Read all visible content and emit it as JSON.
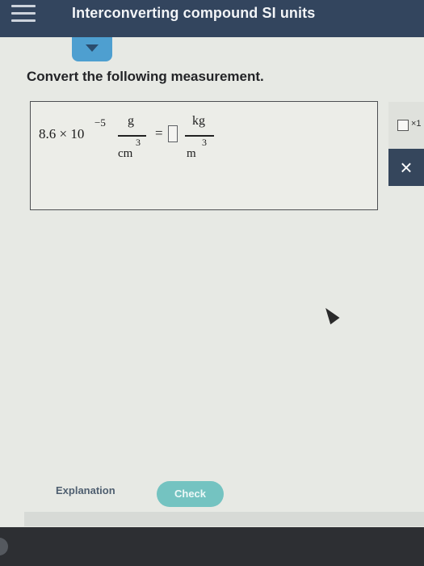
{
  "header": {
    "title": "Interconverting compound SI units",
    "menu_icon": "hamburger-menu-icon",
    "collapse_icon": "caret-down-icon"
  },
  "problem": {
    "prompt": "Convert the following measurement.",
    "coefficient": "8.6 × 10",
    "exponent": "−5",
    "given_numerator": "g",
    "given_denominator": "cm",
    "given_denominator_power": "3",
    "equals": "=",
    "target_numerator": "kg",
    "target_denominator": "m",
    "target_denominator_power": "3",
    "answer_value": ""
  },
  "tools": {
    "x10_label": "×1",
    "clear_label": "×"
  },
  "actions": {
    "explanation_label": "Explanation",
    "check_label": "Check"
  },
  "colors": {
    "header_bg": "#33455e",
    "accent": "#4e9fd0",
    "check_button": "#74c3c1"
  }
}
